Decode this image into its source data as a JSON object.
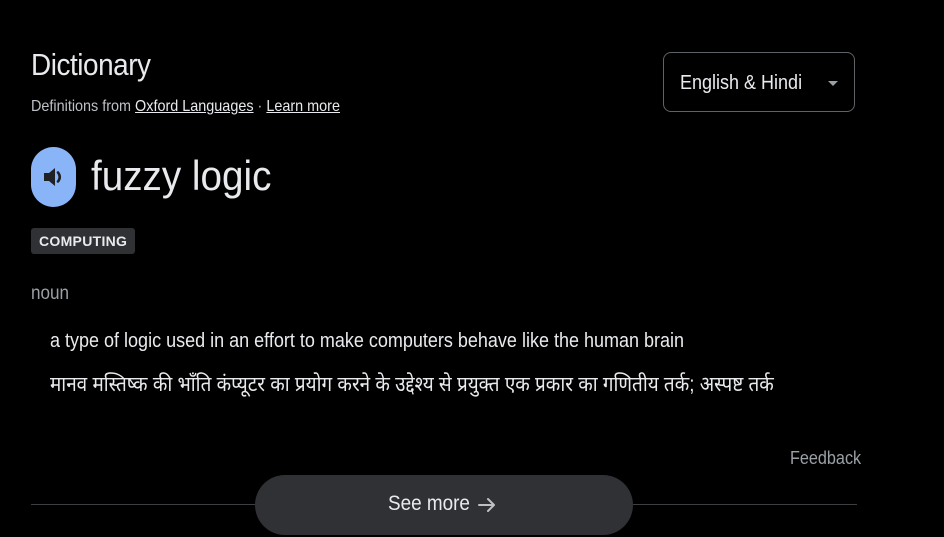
{
  "header": {
    "title": "Dictionary",
    "source_prefix": "Definitions from",
    "source_link": "Oxford Languages",
    "separator": "·",
    "learn_more": "Learn more"
  },
  "language_select": {
    "selected": "English & Hindi",
    "icon": "dropdown-caret"
  },
  "entry": {
    "speaker_icon": "volume-icon",
    "word": "fuzzy logic",
    "domain_tag": "COMPUTING",
    "part_of_speech": "noun",
    "definition_en": "a type of logic used in an effort to make computers behave like the human brain",
    "definition_hi": "मानव मस्तिष्क की भाँति कंप्यूटर का प्रयोग करने के उद्देश्य से प्रयुक्त एक प्रकार का गणितीय तर्क; अस्पष्ट तर्क"
  },
  "footer": {
    "feedback": "Feedback",
    "see_more": "See more",
    "see_more_icon": "arrow-right-icon"
  },
  "colors": {
    "background": "#000000",
    "accent": "#8ab4f8",
    "text_primary": "#e8eaed",
    "text_secondary": "#9aa0a6",
    "pill_bg": "#303134"
  }
}
